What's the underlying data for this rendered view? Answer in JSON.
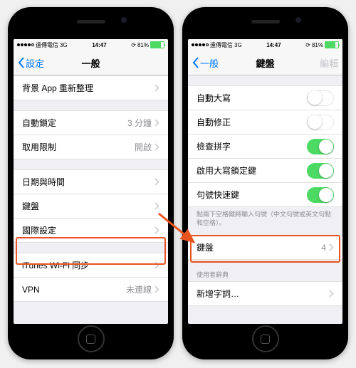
{
  "statusbar": {
    "carrier": "遠傳電信",
    "net": "3G",
    "time": "14:47",
    "batt": "81%"
  },
  "left": {
    "back": "設定",
    "title": "一般",
    "rows": {
      "bg": "背景 App 重新整理",
      "autolock": "自動鎖定",
      "autolock_val": "3 分鐘",
      "restrict": "取用限制",
      "restrict_val": "開啟",
      "datetime": "日期與時間",
      "keyboard": "鍵盤",
      "intl": "國際設定",
      "wifi": "iTunes Wi-Fi 同步",
      "vpn": "VPN",
      "vpn_val": "未連線"
    }
  },
  "right": {
    "back": "一般",
    "title": "鍵盤",
    "edit": "編輯",
    "rows": {
      "autocap": "自動大寫",
      "autocorrect": "自動修正",
      "spell": "檢查拼字",
      "capslock": "啟用大寫鎖定鍵",
      "shortcut": "句號快速鍵",
      "keyboards": "鍵盤",
      "keyboards_val": "4",
      "newphrase": "新增字詞…"
    },
    "note": "點兩下空格鍵將輸入句號（中文句號或英文句點和空格）。",
    "section": "使用者辭典"
  }
}
